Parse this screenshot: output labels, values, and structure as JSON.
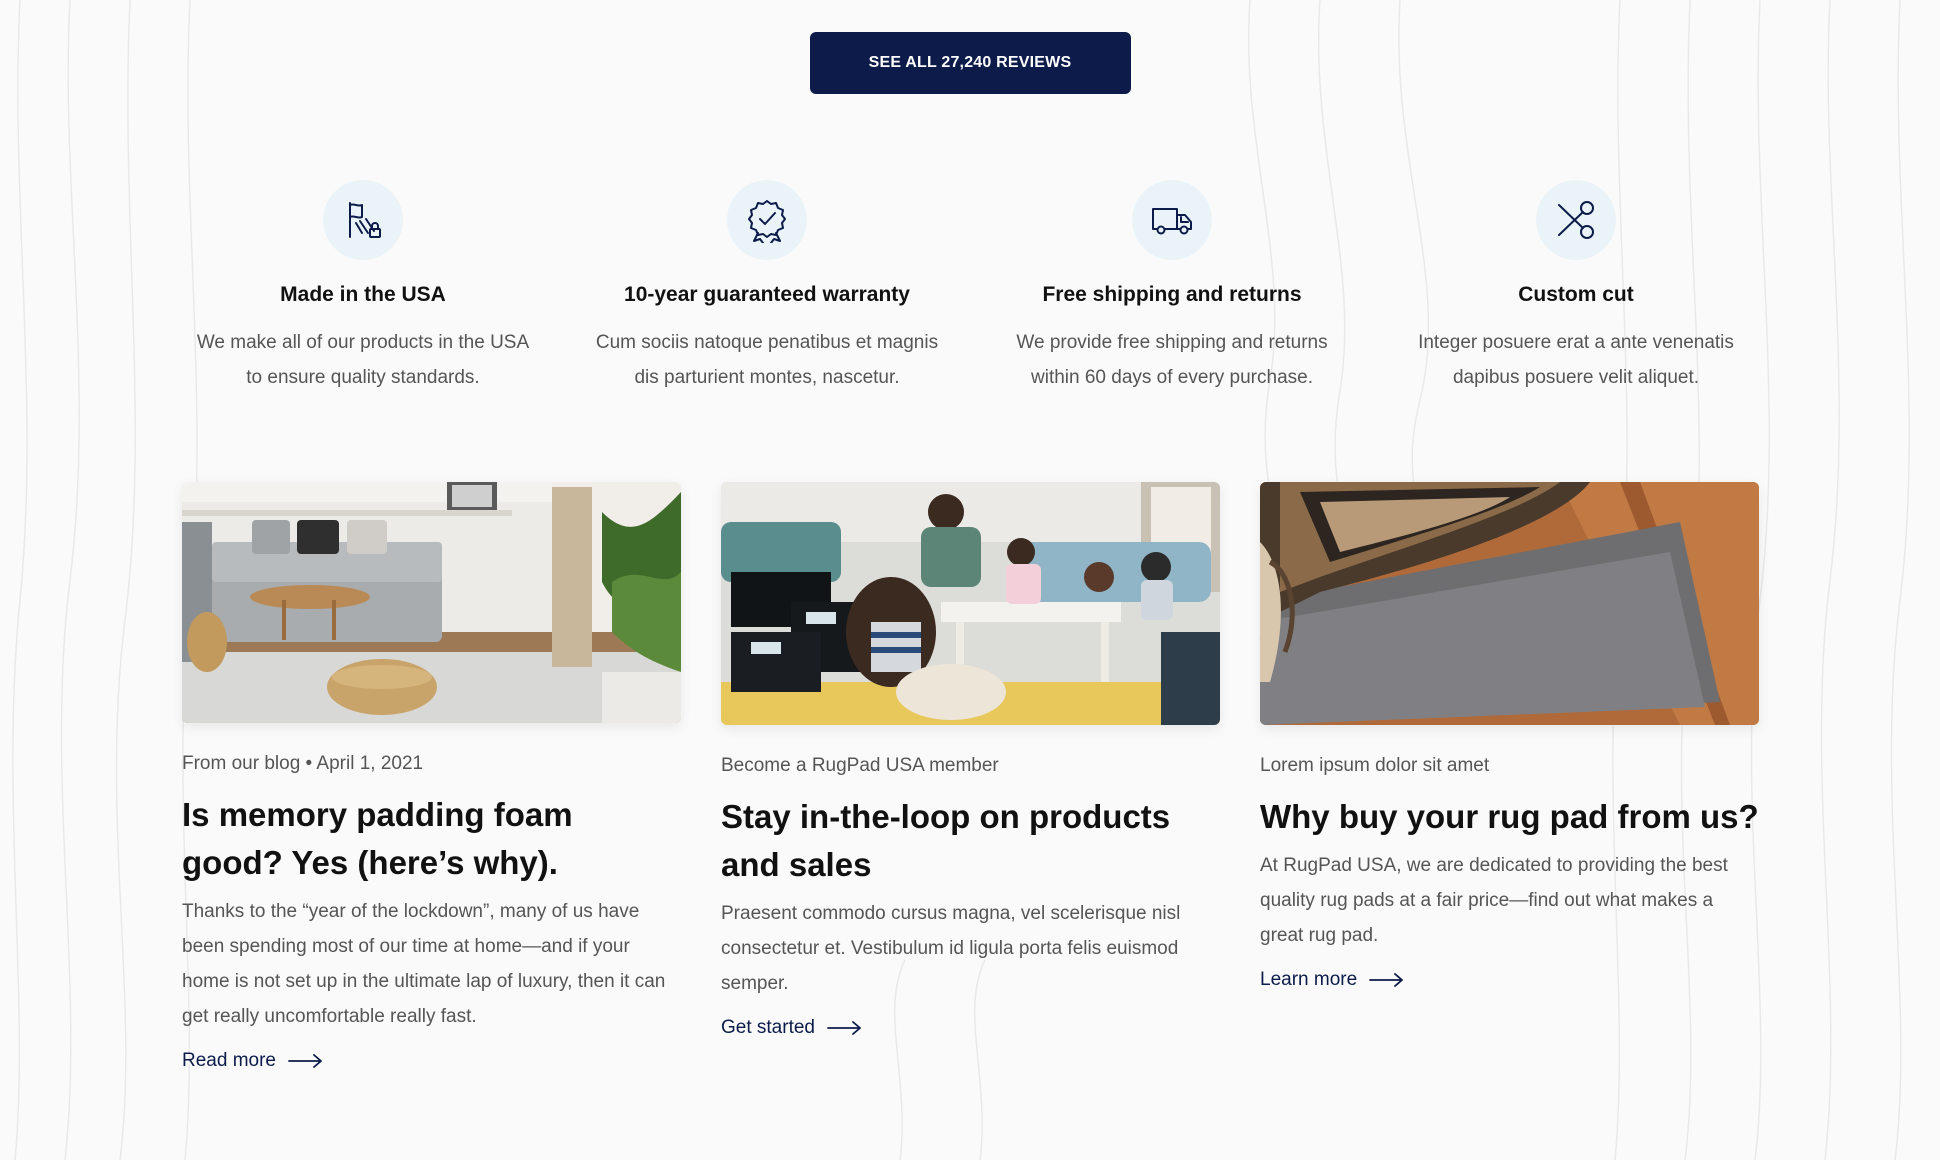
{
  "reviews_button": {
    "label": "SEE ALL 27,240 REVIEWS"
  },
  "features": [
    {
      "icon": "usa-flag-icon",
      "title": "Made in the USA",
      "desc_line1": "We make all of our products in the USA",
      "desc_line2": "to ensure quality standards."
    },
    {
      "icon": "award-ribbon-icon",
      "title": "10-year guaranteed warranty",
      "desc_line1": "Cum sociis natoque penatibus et magnis",
      "desc_line2": "dis parturient montes, nascetur."
    },
    {
      "icon": "delivery-truck-icon",
      "title": "Free shipping and returns",
      "desc_line1": "We provide free shipping and returns",
      "desc_line2": "within 60 days of every purchase."
    },
    {
      "icon": "scissors-icon",
      "title": "Custom cut",
      "desc_line1": "Integer posuere erat a ante venenatis",
      "desc_line2": "dapibus posuere velit aliquet."
    }
  ],
  "cards": [
    {
      "image": "living-room-photo",
      "kicker": "From our blog • April 1, 2021",
      "title": "Is memory padding foam good? Yes (here’s why).",
      "text": "Thanks to the “year of the lockdown”, many of us have been spending most of our time at home—and if your home is not set up in the ultimate lap of luxury, then it can get really uncomfortable really fast.",
      "link": "Read more"
    },
    {
      "image": "family-playroom-photo",
      "kicker": "Become a RugPad USA member",
      "title": "Stay in-the-loop on products and sales",
      "text": "Praesent commodo cursus magna, vel scelerisque nisl consectetur et. Vestibulum id ligula porta felis euismod semper.",
      "link": "Get started"
    },
    {
      "image": "rug-pad-closeup-photo",
      "kicker": "Lorem ipsum dolor sit amet",
      "title": "Why buy your rug pad from us?",
      "text": "At RugPad USA, we are dedicated to providing the best quality rug pads at a fair price—find out what makes a great rug pad.",
      "link": "Learn more"
    }
  ],
  "colors": {
    "primary": "#0c1b4a",
    "icon_bg": "#eaf4f8",
    "body_text": "#555555",
    "heading": "#111111"
  }
}
